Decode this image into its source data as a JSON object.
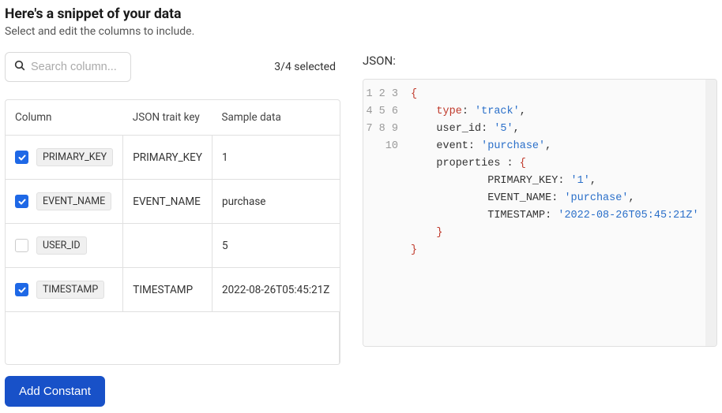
{
  "header": {
    "title": "Here's a snippet of your data",
    "subtitle": "Select and edit the columns to include."
  },
  "search": {
    "placeholder": "Search column..."
  },
  "selection": {
    "text": "3/4 selected"
  },
  "table": {
    "headers": {
      "col": "Column",
      "trait": "JSON trait key",
      "sample": "Sample data"
    },
    "rows": [
      {
        "checked": true,
        "column": "PRIMARY_KEY",
        "trait": "PRIMARY_KEY",
        "sample": "1"
      },
      {
        "checked": true,
        "column": "EVENT_NAME",
        "trait": "EVENT_NAME",
        "sample": "purchase"
      },
      {
        "checked": false,
        "column": "USER_ID",
        "trait": "",
        "sample": "5"
      },
      {
        "checked": true,
        "column": "TIMESTAMP",
        "trait": "TIMESTAMP",
        "sample": "2022-08-26T05:45:21Z"
      }
    ]
  },
  "button": {
    "add_constant": "Add Constant"
  },
  "json": {
    "label": "JSON:",
    "lines": [
      "1",
      "2",
      "3",
      "4",
      "5",
      "6",
      "7",
      "8",
      "9",
      "10"
    ],
    "content": {
      "l1_brace": "{",
      "l2_key": "type",
      "l2_colon": ": ",
      "l2_val": "'track'",
      "l2_comma": ",",
      "l3_key": "user_id",
      "l3_colon": ": ",
      "l3_val": "'5'",
      "l3_comma": ",",
      "l4_key": "event",
      "l4_colon": ": ",
      "l4_val": "'purchase'",
      "l4_comma": ",",
      "l5_key": "properties : ",
      "l5_brace": "{",
      "l6_key": "PRIMARY_KEY: ",
      "l6_val": "'1'",
      "l6_comma": ",",
      "l7_key": "EVENT_NAME: ",
      "l7_val": "'purchase'",
      "l7_comma": ",",
      "l8_key": "TIMESTAMP: ",
      "l8_val": "'2022-08-26T05:45:21Z'",
      "l9_brace": "}",
      "l10_brace": "}"
    }
  }
}
